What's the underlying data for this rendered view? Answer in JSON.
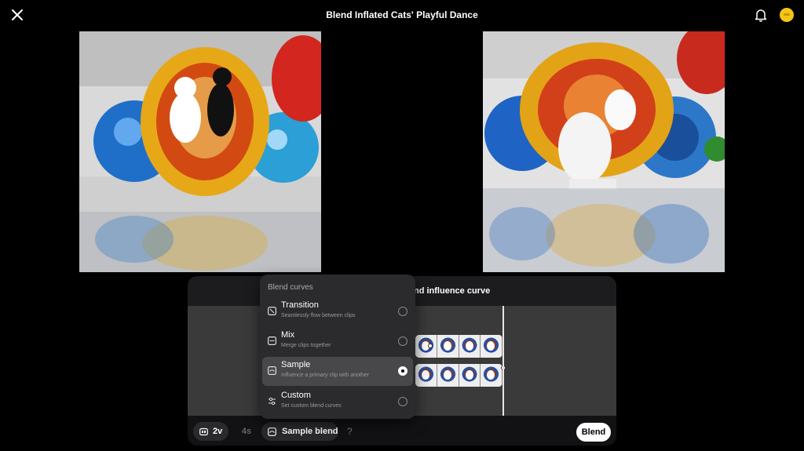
{
  "header": {
    "title": "Blend Inflated Cats' Playful Dance",
    "close_icon": "close-icon",
    "bell_icon": "bell-icon",
    "coin_icon": "coin-icon"
  },
  "panel": {
    "header_text": "nd influence curve"
  },
  "menu": {
    "title": "Blend curves",
    "items": [
      {
        "label": "Transition",
        "description": "Seamlessly flow between clips",
        "icon": "transition-icon",
        "selected": false
      },
      {
        "label": "Mix",
        "description": "Merge clips together",
        "icon": "mix-icon",
        "selected": false
      },
      {
        "label": "Sample",
        "description": "Influence a primary clip with another",
        "icon": "sample-icon",
        "selected": true
      },
      {
        "label": "Custom",
        "description": "Set custom blend curves",
        "icon": "sliders-icon",
        "selected": false
      }
    ]
  },
  "toolbar": {
    "video_count": "2v",
    "duration": "4s",
    "blend_mode": "Sample blend",
    "help": "?",
    "blend_button": "Blend"
  },
  "colors": {
    "accent_coin": "#f5c518",
    "background": "#000000"
  }
}
